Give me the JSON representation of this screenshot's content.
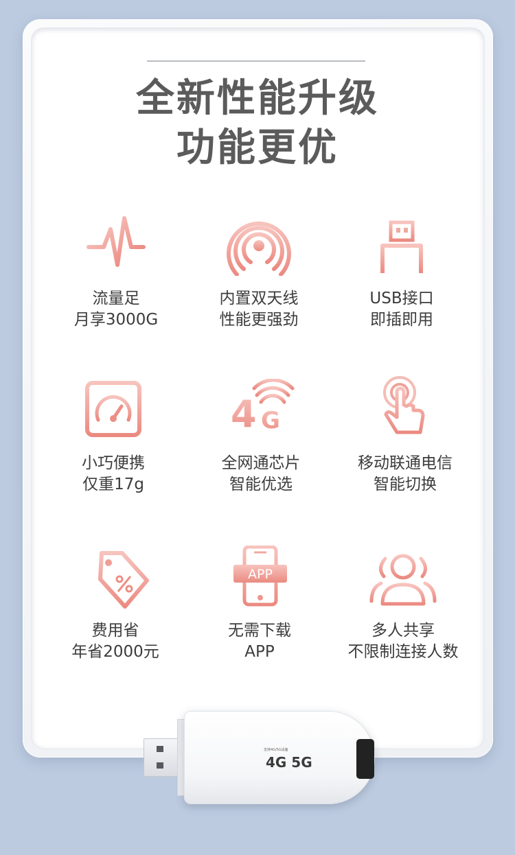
{
  "title": {
    "line1": "全新性能升级",
    "line2": "功能更优"
  },
  "features": [
    {
      "icon": "pulse-icon",
      "line1": "流量足",
      "line2": "月享3000G"
    },
    {
      "icon": "antenna-signal-icon",
      "line1": "内置双天线",
      "line2": "性能更强劲"
    },
    {
      "icon": "usb-connector-icon",
      "line1": "USB接口",
      "line2": "即插即用"
    },
    {
      "icon": "gauge-icon",
      "line1": "小巧便携",
      "line2": "仅重17g"
    },
    {
      "icon": "4g-signal-icon",
      "line1": "全网通芯片",
      "line2": "智能优选"
    },
    {
      "icon": "touch-hand-icon",
      "line1": "移动联通电信",
      "line2": "智能切换"
    },
    {
      "icon": "discount-tag-icon",
      "line1": "费用省",
      "line2": "年省2000元"
    },
    {
      "icon": "phone-app-icon",
      "line1": "无需下载",
      "line2": "APP"
    },
    {
      "icon": "users-group-icon",
      "line1": "多人共享",
      "line2": "不限制连接人数"
    }
  ],
  "icon_text": {
    "four_g": "4",
    "g": "G",
    "app": "APP"
  },
  "device": {
    "small_text": "支持4G/5G设备",
    "logo_text": "4G 5G"
  },
  "colors": {
    "icon_start": "#f5b8b3",
    "icon_end": "#e8796f",
    "title": "#5b5b5b",
    "background": "#bccbe0"
  }
}
